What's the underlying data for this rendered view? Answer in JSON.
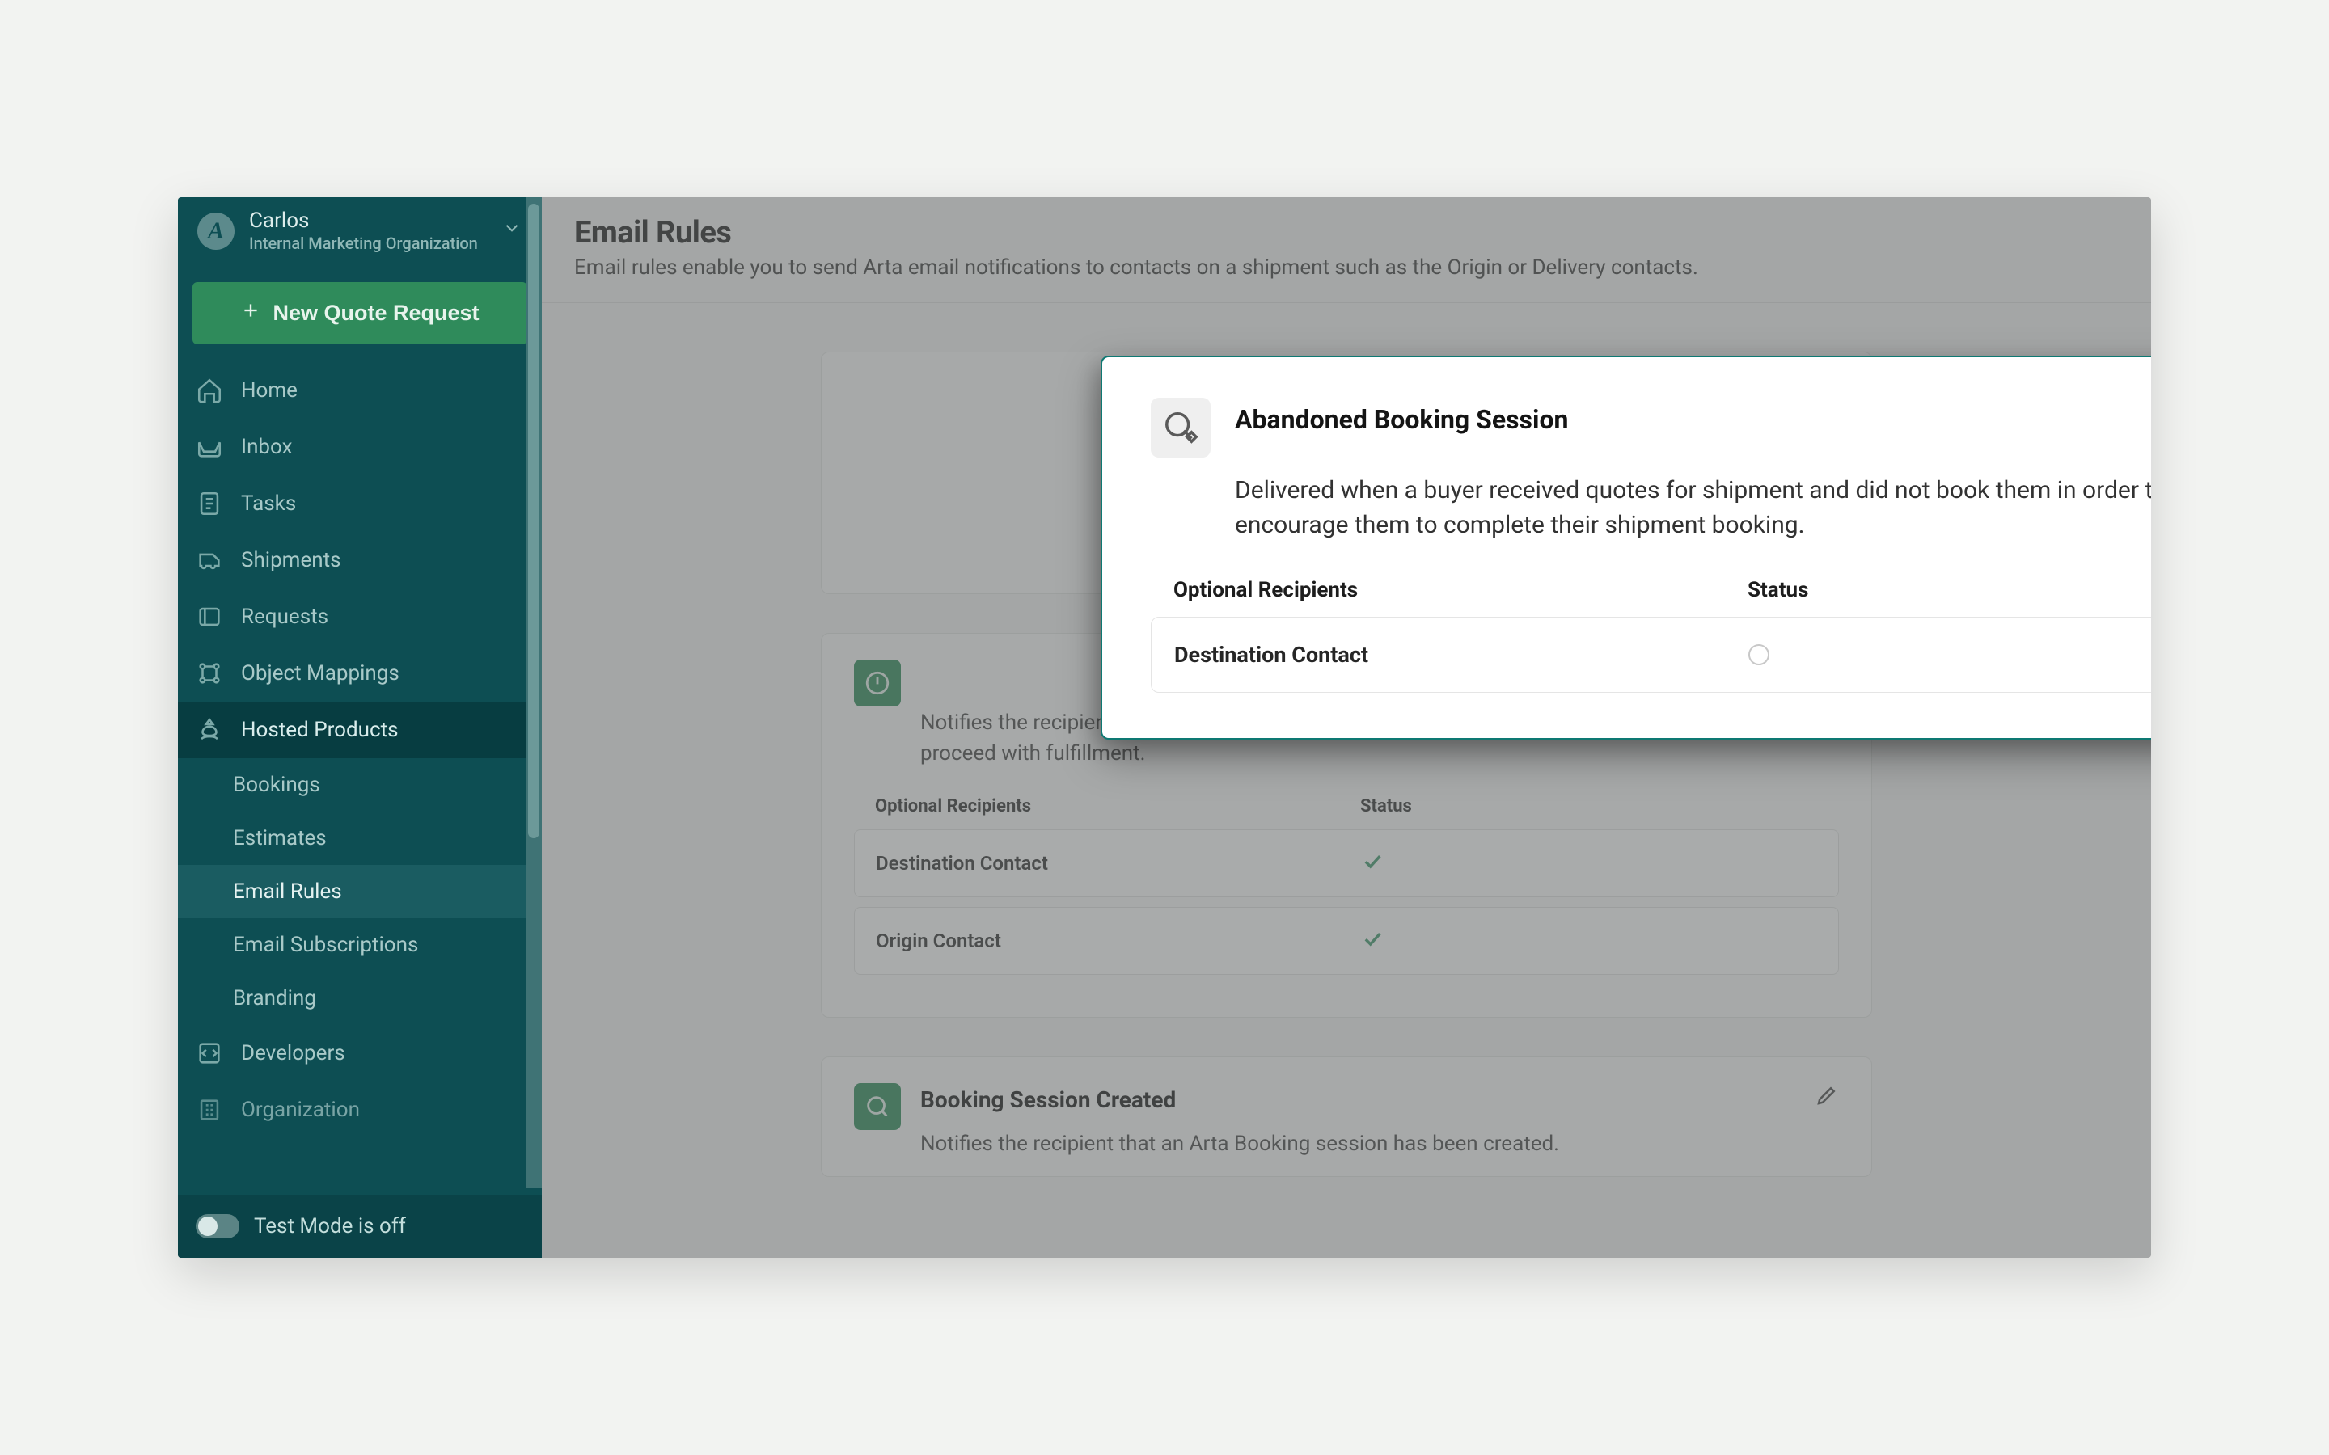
{
  "user": {
    "initial": "A",
    "name": "Carlos",
    "org": "Internal Marketing Organization"
  },
  "quote_button": "New Quote Request",
  "nav": {
    "home": "Home",
    "inbox": "Inbox",
    "tasks": "Tasks",
    "shipments": "Shipments",
    "requests": "Requests",
    "object_mappings": "Object Mappings",
    "hosted_products": "Hosted Products",
    "bookings": "Bookings",
    "estimates": "Estimates",
    "email_rules": "Email Rules",
    "email_subscriptions": "Email Subscriptions",
    "branding": "Branding",
    "developers": "Developers",
    "organization": "Organization"
  },
  "test_mode_label": "Test Mode is off",
  "page": {
    "title": "Email Rules",
    "subtitle": "Email rules enable you to send Arta email notifications to contacts on a shipment such as the Origin or Delivery contacts."
  },
  "table_headers": {
    "recipients": "Optional Recipients",
    "status": "Status"
  },
  "bg_cards": {
    "exception": {
      "body": "Notifies the recipient that there is an exception with the shipment and action is required to proceed with fulfillment.",
      "rows": [
        {
          "label": "Destination Contact",
          "status": "check"
        },
        {
          "label": "Origin Contact",
          "status": "check"
        }
      ]
    },
    "booking_created": {
      "title": "Booking Session Created",
      "body": "Notifies the recipient that an Arta Booking session has been created."
    }
  },
  "modal": {
    "title": "Abandoned Booking Session",
    "body": "Delivered when a buyer received quotes for shipment and did not book them in order to re-engage and encourage them to complete their shipment booking.",
    "rows": [
      {
        "label": "Destination Contact",
        "status": "empty"
      }
    ]
  }
}
